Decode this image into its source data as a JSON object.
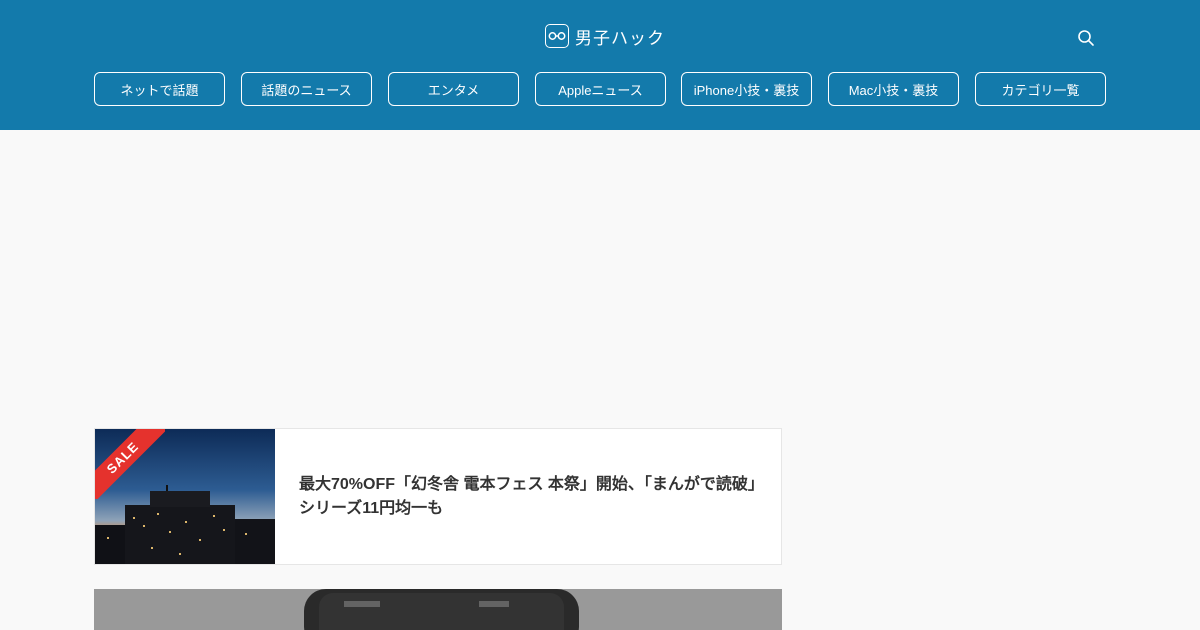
{
  "header": {
    "site_name": "男子ハック",
    "logo_icon": "glasses-icon",
    "search_icon": "search-icon",
    "background": "#137aab"
  },
  "nav": {
    "items": [
      {
        "label": "ネットで話題"
      },
      {
        "label": "話題のニュース"
      },
      {
        "label": "エンタメ"
      },
      {
        "label": "Appleニュース"
      },
      {
        "label": "iPhone小技・裏技"
      },
      {
        "label": "Mac小技・裏技"
      },
      {
        "label": "カテゴリ一覧"
      }
    ]
  },
  "articles": [
    {
      "badge": "SALE",
      "badge_color": "#e5322d",
      "title": "最大70%OFF「幻冬舎 電本フェス 本祭」開始、「まんがで読破」シリーズ11円均一も"
    },
    {
      "title": ""
    }
  ]
}
